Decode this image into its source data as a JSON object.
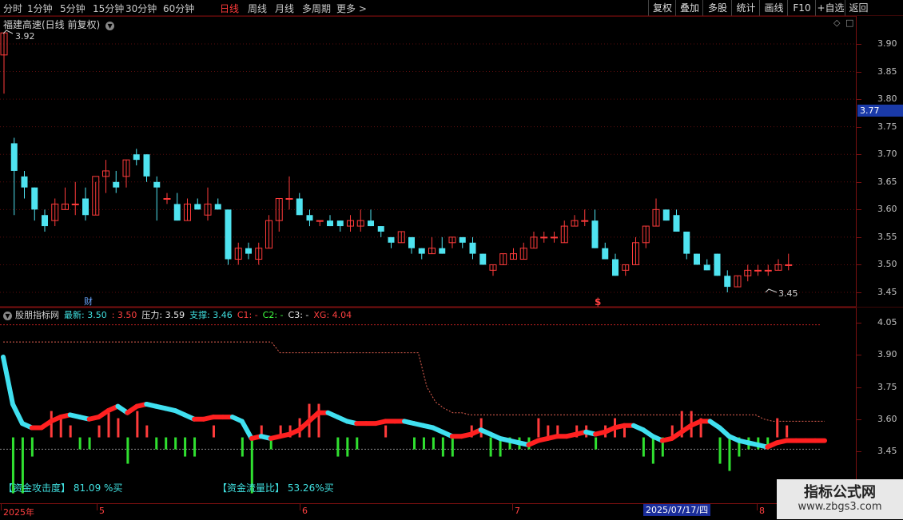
{
  "toolbar": {
    "periods": [
      "分时",
      "1分钟",
      "5分钟",
      "15分钟",
      "30分钟",
      "60分钟",
      "日线",
      "周线",
      "月线",
      "多周期",
      "更多 >"
    ],
    "active_period": "日线",
    "right_buttons": [
      "复权",
      "叠加",
      "多股",
      "统计",
      "画线",
      "F10",
      "+自选",
      "返回"
    ]
  },
  "main_panel": {
    "title": "福建高速(日线 前复权)",
    "y_labels": [
      "3.90",
      "3.85",
      "3.80",
      "3.75",
      "3.70",
      "3.65",
      "3.60",
      "3.55",
      "3.50",
      "3.45"
    ],
    "current_price": "3.77",
    "high_label": "3.92",
    "low_label": "3.45",
    "finance_mark": "财",
    "dollar_mark": "$"
  },
  "indicator_panel": {
    "name": "股朋指标网",
    "values": [
      {
        "label": "最新: 3.50",
        "color": "#40e0e0"
      },
      {
        "label": ": 3.50",
        "color": "#ff4040"
      },
      {
        "label": "压力: 3.59",
        "color": "#e8e8e8"
      },
      {
        "label": "支撑: 3.46",
        "color": "#40e0e0"
      },
      {
        "label": "C1: -",
        "color": "#ff4040"
      },
      {
        "label": "C2: -",
        "color": "#40ff40"
      },
      {
        "label": "C3: -",
        "color": "#e8e8e8"
      },
      {
        "label": "XG: 4.04",
        "color": "#ff4040"
      }
    ],
    "y_labels": [
      "4.05",
      "3.90",
      "3.75",
      "3.60",
      "3.45"
    ],
    "attack_label": "【资金攻击度】",
    "attack_value": "81.09 %买",
    "flow_label": "【资金流量比】",
    "flow_value": "53.26%买"
  },
  "dates": {
    "labels": [
      "2025年",
      "5",
      "6",
      "7",
      "8"
    ],
    "selected": "2025/07/17/四"
  },
  "watermark": {
    "title": "指标公式网",
    "url": "www.zbgs3.com"
  },
  "colors": {
    "up": "#ff3b3b",
    "down": "#4fe3f0",
    "grid": "#7a1010"
  },
  "chart_data": {
    "type": "candlestick",
    "ohlc": [
      [
        3.88,
        3.92,
        3.81,
        3.92
      ],
      [
        3.72,
        3.73,
        3.59,
        3.67
      ],
      [
        3.66,
        3.67,
        3.62,
        3.64
      ],
      [
        3.64,
        3.64,
        3.58,
        3.6
      ],
      [
        3.59,
        3.6,
        3.56,
        3.57
      ],
      [
        3.58,
        3.62,
        3.57,
        3.61
      ],
      [
        3.6,
        3.64,
        3.6,
        3.61
      ],
      [
        3.61,
        3.65,
        3.59,
        3.61
      ],
      [
        3.62,
        3.64,
        3.58,
        3.59
      ],
      [
        3.59,
        3.65,
        3.59,
        3.66
      ],
      [
        3.66,
        3.69,
        3.63,
        3.67
      ],
      [
        3.65,
        3.67,
        3.63,
        3.64
      ],
      [
        3.66,
        3.69,
        3.64,
        3.69
      ],
      [
        3.7,
        3.71,
        3.68,
        3.69
      ],
      [
        3.7,
        3.7,
        3.65,
        3.66
      ],
      [
        3.65,
        3.66,
        3.58,
        3.64
      ],
      [
        3.62,
        3.63,
        3.61,
        3.62
      ],
      [
        3.61,
        3.63,
        3.58,
        3.58
      ],
      [
        3.58,
        3.62,
        3.58,
        3.61
      ],
      [
        3.61,
        3.62,
        3.6,
        3.6
      ],
      [
        3.59,
        3.64,
        3.58,
        3.61
      ],
      [
        3.61,
        3.62,
        3.6,
        3.6
      ],
      [
        3.6,
        3.6,
        3.5,
        3.51
      ],
      [
        3.51,
        3.54,
        3.5,
        3.53
      ],
      [
        3.53,
        3.54,
        3.51,
        3.52
      ],
      [
        3.51,
        3.54,
        3.5,
        3.53
      ],
      [
        3.53,
        3.59,
        3.53,
        3.58
      ],
      [
        3.58,
        3.62,
        3.56,
        3.62
      ],
      [
        3.62,
        3.66,
        3.6,
        3.62
      ],
      [
        3.62,
        3.63,
        3.59,
        3.59
      ],
      [
        3.59,
        3.6,
        3.57,
        3.58
      ],
      [
        3.58,
        3.58,
        3.57,
        3.58
      ],
      [
        3.58,
        3.59,
        3.57,
        3.57
      ],
      [
        3.58,
        3.58,
        3.56,
        3.57
      ],
      [
        3.57,
        3.59,
        3.56,
        3.58
      ],
      [
        3.57,
        3.6,
        3.56,
        3.58
      ],
      [
        3.58,
        3.6,
        3.57,
        3.57
      ],
      [
        3.57,
        3.57,
        3.55,
        3.56
      ],
      [
        3.55,
        3.55,
        3.53,
        3.54
      ],
      [
        3.54,
        3.56,
        3.54,
        3.56
      ],
      [
        3.55,
        3.55,
        3.52,
        3.53
      ],
      [
        3.53,
        3.53,
        3.51,
        3.52
      ],
      [
        3.52,
        3.55,
        3.52,
        3.53
      ],
      [
        3.53,
        3.55,
        3.52,
        3.52
      ],
      [
        3.54,
        3.55,
        3.53,
        3.55
      ],
      [
        3.55,
        3.55,
        3.53,
        3.54
      ],
      [
        3.54,
        3.55,
        3.51,
        3.52
      ],
      [
        3.52,
        3.52,
        3.5,
        3.5
      ],
      [
        3.49,
        3.5,
        3.48,
        3.5
      ],
      [
        3.5,
        3.52,
        3.5,
        3.52
      ],
      [
        3.51,
        3.53,
        3.51,
        3.52
      ],
      [
        3.51,
        3.54,
        3.51,
        3.53
      ],
      [
        3.53,
        3.56,
        3.53,
        3.55
      ],
      [
        3.55,
        3.56,
        3.54,
        3.55
      ],
      [
        3.55,
        3.56,
        3.54,
        3.55
      ],
      [
        3.54,
        3.58,
        3.54,
        3.57
      ],
      [
        3.57,
        3.59,
        3.57,
        3.58
      ],
      [
        3.58,
        3.6,
        3.57,
        3.58
      ],
      [
        3.58,
        3.6,
        3.53,
        3.53
      ],
      [
        3.53,
        3.54,
        3.51,
        3.51
      ],
      [
        3.51,
        3.52,
        3.48,
        3.48
      ],
      [
        3.49,
        3.5,
        3.48,
        3.5
      ],
      [
        3.5,
        3.55,
        3.5,
        3.54
      ],
      [
        3.54,
        3.57,
        3.53,
        3.57
      ],
      [
        3.57,
        3.62,
        3.57,
        3.6
      ],
      [
        3.6,
        3.6,
        3.58,
        3.58
      ],
      [
        3.59,
        3.6,
        3.56,
        3.56
      ],
      [
        3.56,
        3.56,
        3.51,
        3.52
      ],
      [
        3.52,
        3.52,
        3.5,
        3.5
      ],
      [
        3.5,
        3.51,
        3.49,
        3.49
      ],
      [
        3.52,
        3.52,
        3.48,
        3.48
      ],
      [
        3.48,
        3.49,
        3.45,
        3.46
      ],
      [
        3.46,
        3.48,
        3.46,
        3.48
      ],
      [
        3.48,
        3.5,
        3.47,
        3.49
      ],
      [
        3.49,
        3.5,
        3.48,
        3.49
      ],
      [
        3.49,
        3.5,
        3.48,
        3.49
      ],
      [
        3.49,
        3.51,
        3.49,
        3.5
      ],
      [
        3.5,
        3.52,
        3.49,
        3.5
      ]
    ],
    "indicator": {
      "line": [
        3.89,
        3.67,
        3.58,
        3.56,
        3.56,
        3.59,
        3.61,
        3.62,
        3.61,
        3.6,
        3.61,
        3.64,
        3.66,
        3.63,
        3.66,
        3.67,
        3.66,
        3.65,
        3.64,
        3.62,
        3.6,
        3.6,
        3.61,
        3.61,
        3.61,
        3.59,
        3.51,
        3.52,
        3.51,
        3.52,
        3.53,
        3.55,
        3.59,
        3.63,
        3.63,
        3.61,
        3.59,
        3.58,
        3.58,
        3.58,
        3.59,
        3.59,
        3.59,
        3.58,
        3.57,
        3.56,
        3.54,
        3.52,
        3.52,
        3.53,
        3.55,
        3.53,
        3.51,
        3.5,
        3.49,
        3.48,
        3.5,
        3.51,
        3.52,
        3.52,
        3.53,
        3.54,
        3.53,
        3.54,
        3.56,
        3.57,
        3.57,
        3.55,
        3.52,
        3.5,
        3.51,
        3.54,
        3.57,
        3.59,
        3.59,
        3.56,
        3.52,
        3.5,
        3.49,
        3.48,
        3.47,
        3.49,
        3.5,
        3.5,
        3.5,
        3.5,
        3.5
      ],
      "pressure_line": [
        3.96,
        3.96,
        3.96,
        3.96,
        3.96,
        3.96,
        3.96,
        3.96,
        3.96,
        3.96,
        3.96,
        3.96,
        3.96,
        3.96,
        3.96,
        3.96,
        3.96,
        3.96,
        3.96,
        3.96,
        3.96,
        3.96,
        3.96,
        3.96,
        3.96,
        3.96,
        3.96,
        3.96,
        3.96,
        3.96,
        3.96,
        3.96,
        3.91,
        3.91,
        3.91,
        3.91,
        3.91,
        3.91,
        3.91,
        3.91,
        3.91,
        3.91,
        3.91,
        3.91,
        3.91,
        3.91,
        3.91,
        3.91,
        3.91,
        3.75,
        3.68,
        3.65,
        3.63,
        3.63,
        3.62,
        3.62,
        3.62,
        3.62,
        3.62,
        3.62,
        3.62,
        3.62,
        3.62,
        3.62,
        3.62,
        3.62,
        3.62,
        3.62,
        3.62,
        3.62,
        3.62,
        3.62,
        3.62,
        3.62,
        3.62,
        3.62,
        3.62,
        3.62,
        3.62,
        3.62,
        3.62,
        3.62,
        3.62,
        3.62,
        3.62,
        3.62,
        3.62,
        3.62,
        3.6,
        3.59,
        3.59,
        3.59,
        3.59,
        3.59,
        3.59,
        3.59
      ],
      "xg_level": 4.04,
      "support_level": 3.46
    }
  }
}
